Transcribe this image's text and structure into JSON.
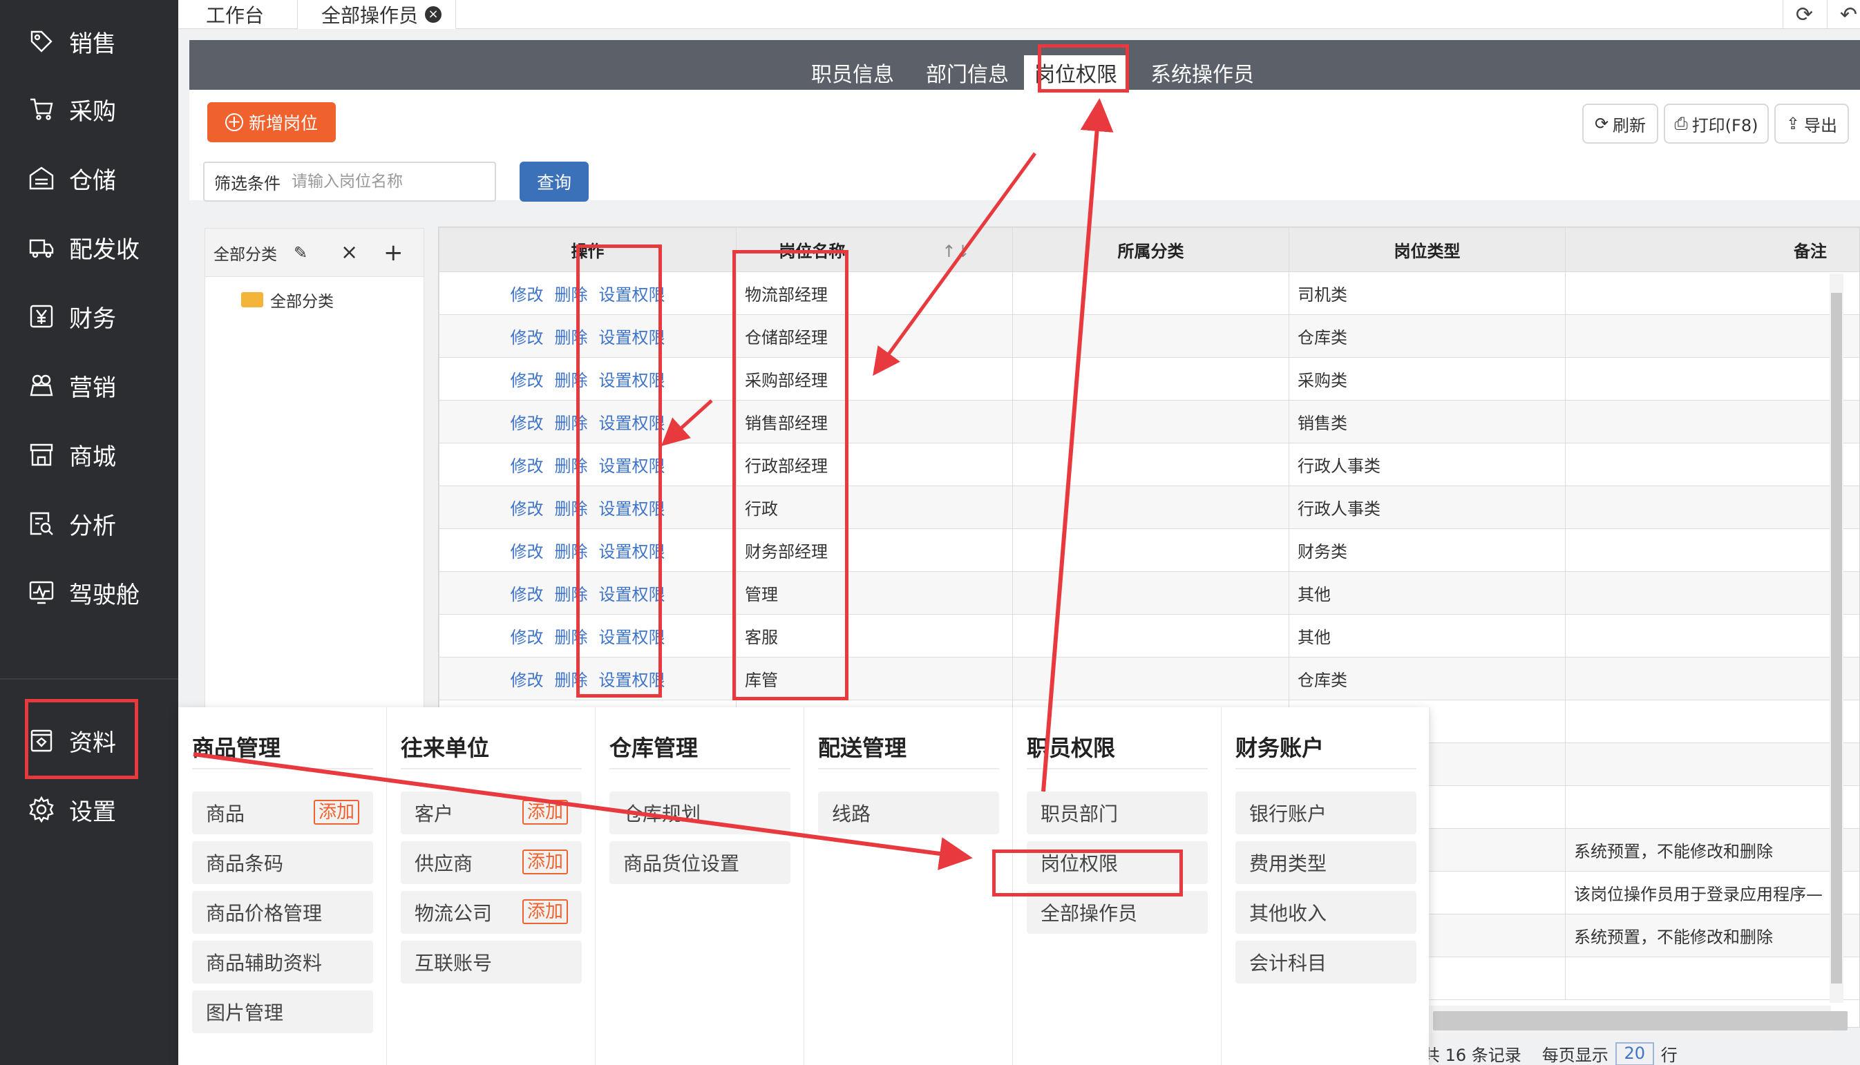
{
  "sidebar": {
    "items": [
      {
        "label": "销售",
        "icon": "tag-icon"
      },
      {
        "label": "采购",
        "icon": "cart-icon"
      },
      {
        "label": "仓储",
        "icon": "warehouse-icon"
      },
      {
        "label": "配发收",
        "icon": "truck-icon"
      },
      {
        "label": "财务",
        "icon": "yen-icon"
      },
      {
        "label": "营销",
        "icon": "gift-icon"
      },
      {
        "label": "商城",
        "icon": "store-icon"
      },
      {
        "label": "分析",
        "icon": "analysis-icon"
      },
      {
        "label": "驾驶舱",
        "icon": "dashboard-icon"
      },
      {
        "label": "资料",
        "icon": "data-icon"
      },
      {
        "label": "设置",
        "icon": "gear-icon"
      }
    ]
  },
  "topbar": {
    "tabs": [
      "工作台",
      "全部操作员"
    ],
    "close_glyph": "×"
  },
  "subnav": {
    "tabs": [
      "职员信息",
      "部门信息",
      "岗位权限",
      "系统操作员"
    ],
    "active": "岗位权限"
  },
  "toolbar": {
    "add_label": "新增岗位",
    "refresh_label": "刷新",
    "print_label": "打印(F8)",
    "export_label": "导出"
  },
  "filter": {
    "label": "筛选条件",
    "placeholder": "请输入岗位名称",
    "query_label": "查询"
  },
  "tree": {
    "header": "全部分类",
    "close_glyph": "×",
    "add_glyph": "+",
    "node": "全部分类"
  },
  "table": {
    "columns": [
      "操作",
      "岗位名称",
      "所属分类",
      "岗位类型",
      "备注"
    ],
    "ops": [
      "修改",
      "删除",
      "设置权限"
    ],
    "rows": [
      {
        "name": "物流部经理",
        "category": "",
        "type": "司机类",
        "note": ""
      },
      {
        "name": "仓储部经理",
        "category": "",
        "type": "仓库类",
        "note": ""
      },
      {
        "name": "采购部经理",
        "category": "",
        "type": "采购类",
        "note": ""
      },
      {
        "name": "销售部经理",
        "category": "",
        "type": "销售类",
        "note": ""
      },
      {
        "name": "行政部经理",
        "category": "",
        "type": "行政人事类",
        "note": ""
      },
      {
        "name": "行政",
        "category": "",
        "type": "行政人事类",
        "note": ""
      },
      {
        "name": "财务部经理",
        "category": "",
        "type": "财务类",
        "note": ""
      },
      {
        "name": "管理",
        "category": "",
        "type": "其他",
        "note": ""
      },
      {
        "name": "客服",
        "category": "",
        "type": "其他",
        "note": ""
      },
      {
        "name": "库管",
        "category": "",
        "type": "仓库类",
        "note": ""
      },
      {
        "name": "",
        "category": "",
        "type": "",
        "note": ""
      },
      {
        "name": "",
        "category": "",
        "type": "",
        "note": ""
      },
      {
        "name": "",
        "category": "",
        "type": "",
        "note": ""
      },
      {
        "name": "",
        "category": "",
        "type": "",
        "note": "系统预置，不能修改和删除"
      },
      {
        "name": "",
        "category": "",
        "type": "",
        "note": "该岗位操作员用于登录应用程序—"
      },
      {
        "name": "",
        "category": "",
        "type": "",
        "note": "系统预置，不能修改和删除"
      },
      {
        "name": "",
        "category": "",
        "type": "",
        "note": ""
      }
    ]
  },
  "pager": {
    "per_page_label": "每页显示",
    "per_page": "20",
    "rows_unit": "行",
    "record_text": "共 16 条记录"
  },
  "mega_menu": {
    "add_tag": "添加",
    "columns": [
      {
        "title": "商品管理",
        "items": [
          {
            "label": "商品",
            "add": true
          },
          {
            "label": "商品条码",
            "add": false
          },
          {
            "label": "商品价格管理",
            "add": false
          },
          {
            "label": "商品辅助资料",
            "add": false
          },
          {
            "label": "图片管理",
            "add": false
          }
        ]
      },
      {
        "title": "往来单位",
        "items": [
          {
            "label": "客户",
            "add": true
          },
          {
            "label": "供应商",
            "add": true
          },
          {
            "label": "物流公司",
            "add": true
          },
          {
            "label": "互联账号",
            "add": false
          }
        ]
      },
      {
        "title": "仓库管理",
        "items": [
          {
            "label": "仓库规划",
            "add": false
          },
          {
            "label": "商品货位设置",
            "add": false
          }
        ]
      },
      {
        "title": "配送管理",
        "items": [
          {
            "label": "线路",
            "add": false
          }
        ]
      },
      {
        "title": "职员权限",
        "items": [
          {
            "label": "职员部门",
            "add": false
          },
          {
            "label": "岗位权限",
            "add": false
          },
          {
            "label": "全部操作员",
            "add": false
          }
        ]
      },
      {
        "title": "财务账户",
        "items": [
          {
            "label": "银行账户",
            "add": false
          },
          {
            "label": "费用类型",
            "add": false
          },
          {
            "label": "其他收入",
            "add": false
          },
          {
            "label": "会计科目",
            "add": false
          }
        ]
      }
    ]
  },
  "colors": {
    "sidebar_bg": "#2b2d31",
    "accent_orange": "#f0622d",
    "query_blue": "#3a71b8",
    "link_blue": "#3e74c9",
    "annotation_red": "#e8393f"
  }
}
